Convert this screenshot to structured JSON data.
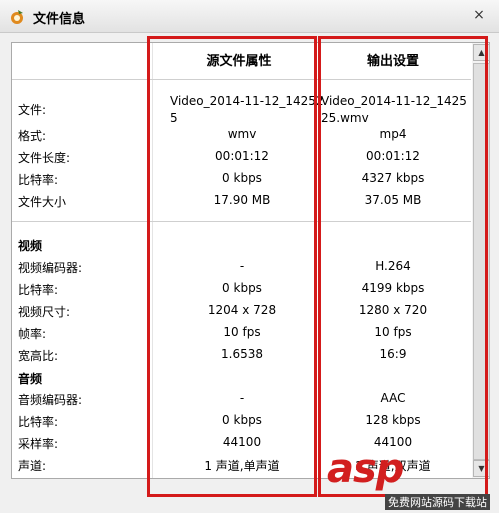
{
  "window": {
    "title": "文件信息",
    "close_glyph": "×"
  },
  "columns": {
    "source": "源文件属性",
    "output": "输出设置"
  },
  "file_rows": [
    {
      "label": "文件:",
      "source": "Video_2014-11-12_14252\n5",
      "output": "Video_2014-11-12_142525.wmv"
    },
    {
      "label": "格式:",
      "source": "wmv",
      "output": "mp4"
    },
    {
      "label": "文件长度:",
      "source": "00:01:12",
      "output": "00:01:12"
    },
    {
      "label": "比特率:",
      "source": "0 kbps",
      "output": "4327 kbps"
    },
    {
      "label": "文件大小",
      "source": "17.90 MB",
      "output": "37.05 MB"
    }
  ],
  "video": {
    "title": "视频",
    "rows": [
      {
        "label": "视频编码器:",
        "source": "-",
        "output": "H.264"
      },
      {
        "label": "比特率:",
        "source": "0 kbps",
        "output": "4199 kbps"
      },
      {
        "label": "视频尺寸:",
        "source": "1204 x 728",
        "output": "1280 x 720"
      },
      {
        "label": "帧率:",
        "source": "10 fps",
        "output": "10 fps"
      },
      {
        "label": "宽高比:",
        "source": "1.6538",
        "output": "16:9"
      }
    ]
  },
  "audio": {
    "title": "音频",
    "rows": [
      {
        "label": "音频编码器:",
        "source": "-",
        "output": "AAC"
      },
      {
        "label": "比特率:",
        "source": "0 kbps",
        "output": "128 kbps"
      },
      {
        "label": "采样率:",
        "source": "44100",
        "output": "44100"
      },
      {
        "label": "声道:",
        "source": "1 声道,单声道",
        "output": "2 声道,双声道"
      }
    ]
  },
  "watermark": {
    "text": "asp",
    "subtext": "免费网站源码下载站"
  },
  "colors": {
    "highlight": "#d41a1a"
  }
}
